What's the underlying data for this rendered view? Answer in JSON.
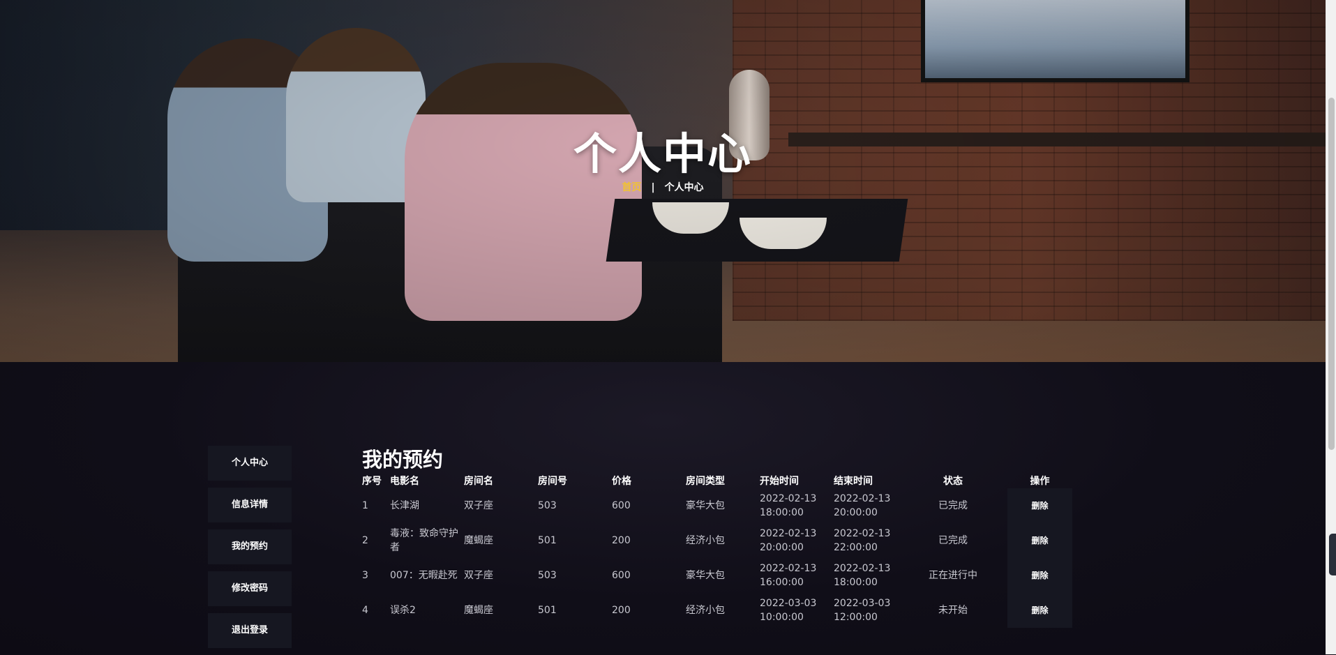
{
  "hero": {
    "title": "个人中心",
    "breadcrumb": {
      "home": "首页",
      "separator": "|",
      "current": "个人中心"
    }
  },
  "sidebar": {
    "items": [
      {
        "label": "个人中心"
      },
      {
        "label": "信息详情"
      },
      {
        "label": "我的预约"
      },
      {
        "label": "修改密码"
      },
      {
        "label": "退出登录"
      }
    ]
  },
  "main": {
    "title": "我的预约",
    "columns": [
      "序号",
      "电影名",
      "房间名",
      "房间号",
      "价格",
      "房间类型",
      "开始时间",
      "结束时间",
      "状态",
      "操作"
    ],
    "rows": [
      {
        "no": "1",
        "movie": "长津湖",
        "room": "双子座",
        "room_no": "503",
        "price": "600",
        "type": "豪华大包",
        "start": "2022-02-13 18:00:00",
        "end": "2022-02-13 20:00:00",
        "status": "已完成",
        "action": "删除"
      },
      {
        "no": "2",
        "movie": "毒液：致命守护者",
        "room": "魔蝎座",
        "room_no": "501",
        "price": "200",
        "type": "经济小包",
        "start": "2022-02-13 20:00:00",
        "end": "2022-02-13 22:00:00",
        "status": "已完成",
        "action": "删除"
      },
      {
        "no": "3",
        "movie": "007：无暇赴死",
        "room": "双子座",
        "room_no": "503",
        "price": "600",
        "type": "豪华大包",
        "start": "2022-02-13 16:00:00",
        "end": "2022-02-13 18:00:00",
        "status": "正在进行中",
        "action": "删除"
      },
      {
        "no": "4",
        "movie": "误杀2",
        "room": "魔蝎座",
        "room_no": "501",
        "price": "200",
        "type": "经济小包",
        "start": "2022-03-03 10:00:00",
        "end": "2022-03-03 12:00:00",
        "status": "未开始",
        "action": "删除"
      }
    ]
  },
  "colors": {
    "accent": "#f1c232",
    "background": "#0f0d16",
    "panel": "#161721"
  }
}
